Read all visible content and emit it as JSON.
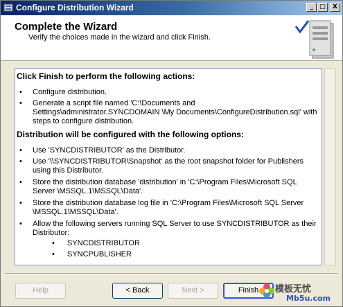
{
  "window": {
    "title": "Configure Distribution Wizard",
    "controls": {
      "minimize": "_",
      "maximize": "□",
      "close": "X"
    }
  },
  "header": {
    "title": "Complete the Wizard",
    "subtitle": "Verify the choices made in the wizard and click Finish."
  },
  "content": {
    "actions_heading": "Click Finish to perform the following actions:",
    "actions": [
      "Configure distribution.",
      "Generate a script file named 'C:\\Documents and Settings\\administrator.SYNCDOMAIN \\My Documents\\ConfigureDistribution.sql' with steps to configure distribution."
    ],
    "options_heading": "Distribution will be configured with the following options:",
    "options": [
      "Use 'SYNCDISTRIBUTOR' as the Distributor.",
      "Use '\\\\SYNCDISTRIBUTOR\\Snapshot' as the root snapshot folder for Publishers using this Distributor.",
      "Store the distribution database 'distribution' in 'C:\\Program Files\\Microsoft SQL Server \\MSSQL.1\\MSSQL\\Data'.",
      "Store the distribution database log file in 'C:\\Program Files\\Microsoft SQL Server \\MSSQL.1\\MSSQL\\Data'.",
      "Allow the following servers running SQL Server to use SYNCDISTRIBUTOR as their Distributor:"
    ],
    "servers": [
      "SYNCDISTRIBUTOR",
      "SYNCPUBLISHER"
    ],
    "bullet_char": "•"
  },
  "buttons": {
    "help": "Help",
    "back": "< Back",
    "next": "Next >",
    "finish": "Finish"
  },
  "watermark": {
    "line1": "模板无忧",
    "line2": "Mb5u.com"
  }
}
